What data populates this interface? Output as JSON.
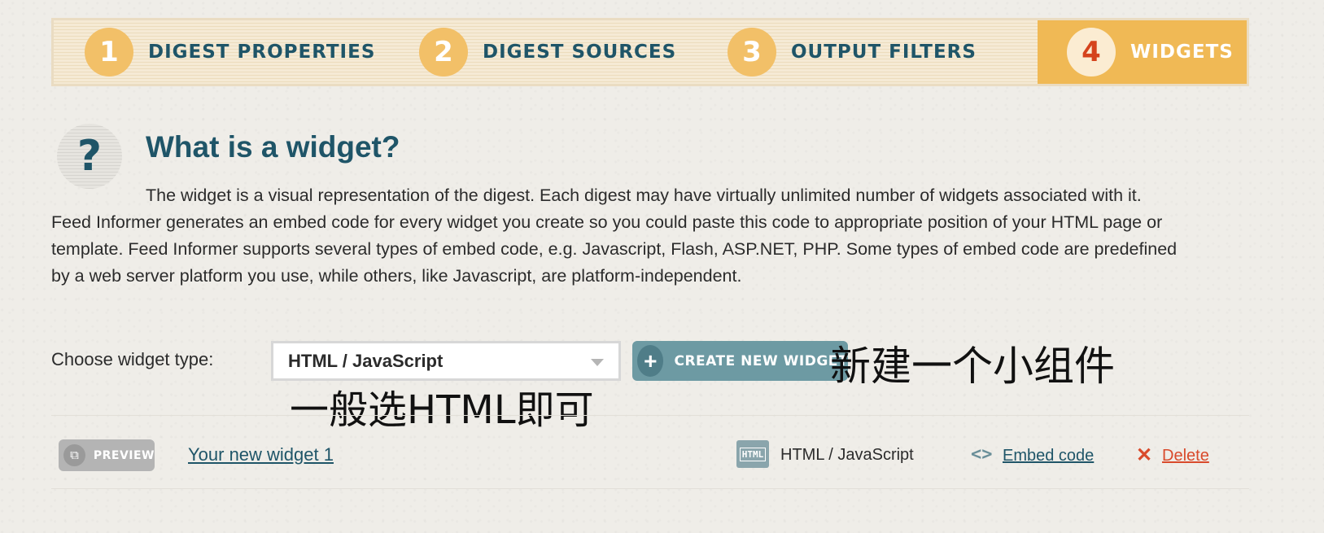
{
  "steps": [
    {
      "num": "1",
      "label": "DIGEST PROPERTIES",
      "active": false
    },
    {
      "num": "2",
      "label": "DIGEST SOURCES",
      "active": false
    },
    {
      "num": "3",
      "label": "OUTPUT FILTERS",
      "active": false
    },
    {
      "num": "4",
      "label": "WIDGETS",
      "active": true
    }
  ],
  "intro": {
    "icon": "?",
    "title": "What is a widget?",
    "text": "The widget is a visual representation of the digest. Each digest may have virtually unlimited number of widgets associated with it. Feed Informer generates an embed code for every widget you create so you could paste this code to appropriate position of your HTML page or template. Feed Informer supports several types of embed code, e.g. Javascript, Flash, ASP.NET, PHP. Some types of embed code are predefined by a web server platform you use, while others, like Javascript, are platform-independent."
  },
  "widget_type": {
    "label": "Choose widget type:",
    "selected": "HTML / JavaScript",
    "create_button": "CREATE NEW WIDGET",
    "create_icon": "+"
  },
  "annotations": {
    "create_note": "新建一个小组件",
    "select_note": "一般选HTML即可"
  },
  "widgets": [
    {
      "preview_label": "PREVIEW",
      "name": "Your new widget 1",
      "type_icon": "HTML",
      "type": "HTML / JavaScript",
      "embed_label": "Embed code",
      "delete_label": "Delete"
    }
  ],
  "colors": {
    "accent": "#f0b955",
    "heading": "#1f5568",
    "delete": "#d94a2b",
    "button": "#6d9aa3"
  }
}
